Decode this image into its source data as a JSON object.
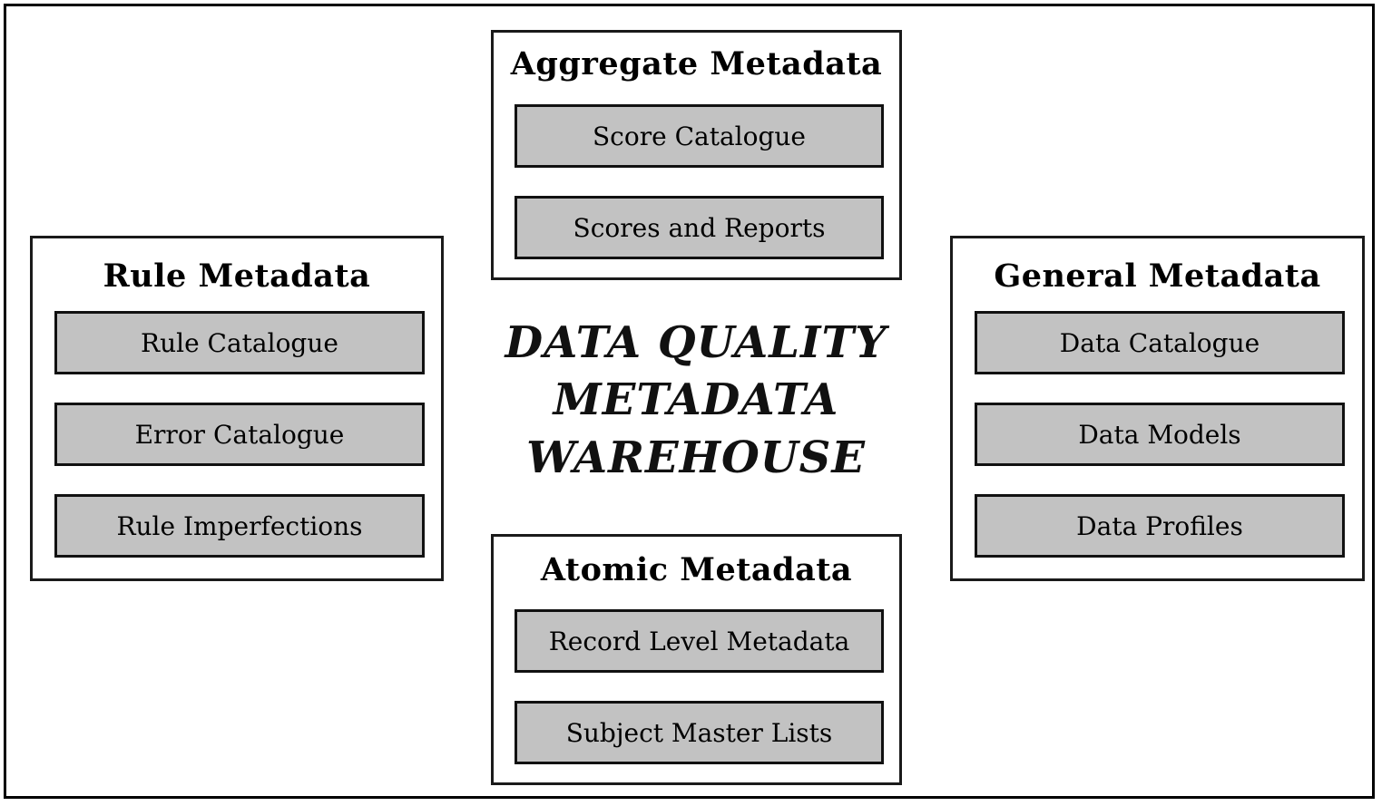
{
  "figure": {
    "center_title_lines": [
      "DATA QUALITY",
      "METADATA",
      "WAREHOUSE"
    ],
    "center_title_full": "DATA QUALITY METADATA WAREHOUSE"
  },
  "colors": {
    "item_fill": "#c2c2c2",
    "border": "#111111",
    "panel_background": "#ffffff",
    "text": "#000000"
  },
  "panels": {
    "rule": {
      "title": "Rule Metadata",
      "items": [
        {
          "label": "Rule Catalogue"
        },
        {
          "label": "Error Catalogue"
        },
        {
          "label": "Rule Imperfections"
        }
      ]
    },
    "aggregate": {
      "title": "Aggregate Metadata",
      "items": [
        {
          "label": "Score Catalogue"
        },
        {
          "label": "Scores and Reports"
        }
      ]
    },
    "atomic": {
      "title": "Atomic Metadata",
      "items": [
        {
          "label": "Record Level Metadata"
        },
        {
          "label": "Subject Master Lists"
        }
      ]
    },
    "general": {
      "title": "General Metadata",
      "items": [
        {
          "label": "Data Catalogue"
        },
        {
          "label": "Data Models"
        },
        {
          "label": "Data Profiles"
        }
      ]
    }
  }
}
